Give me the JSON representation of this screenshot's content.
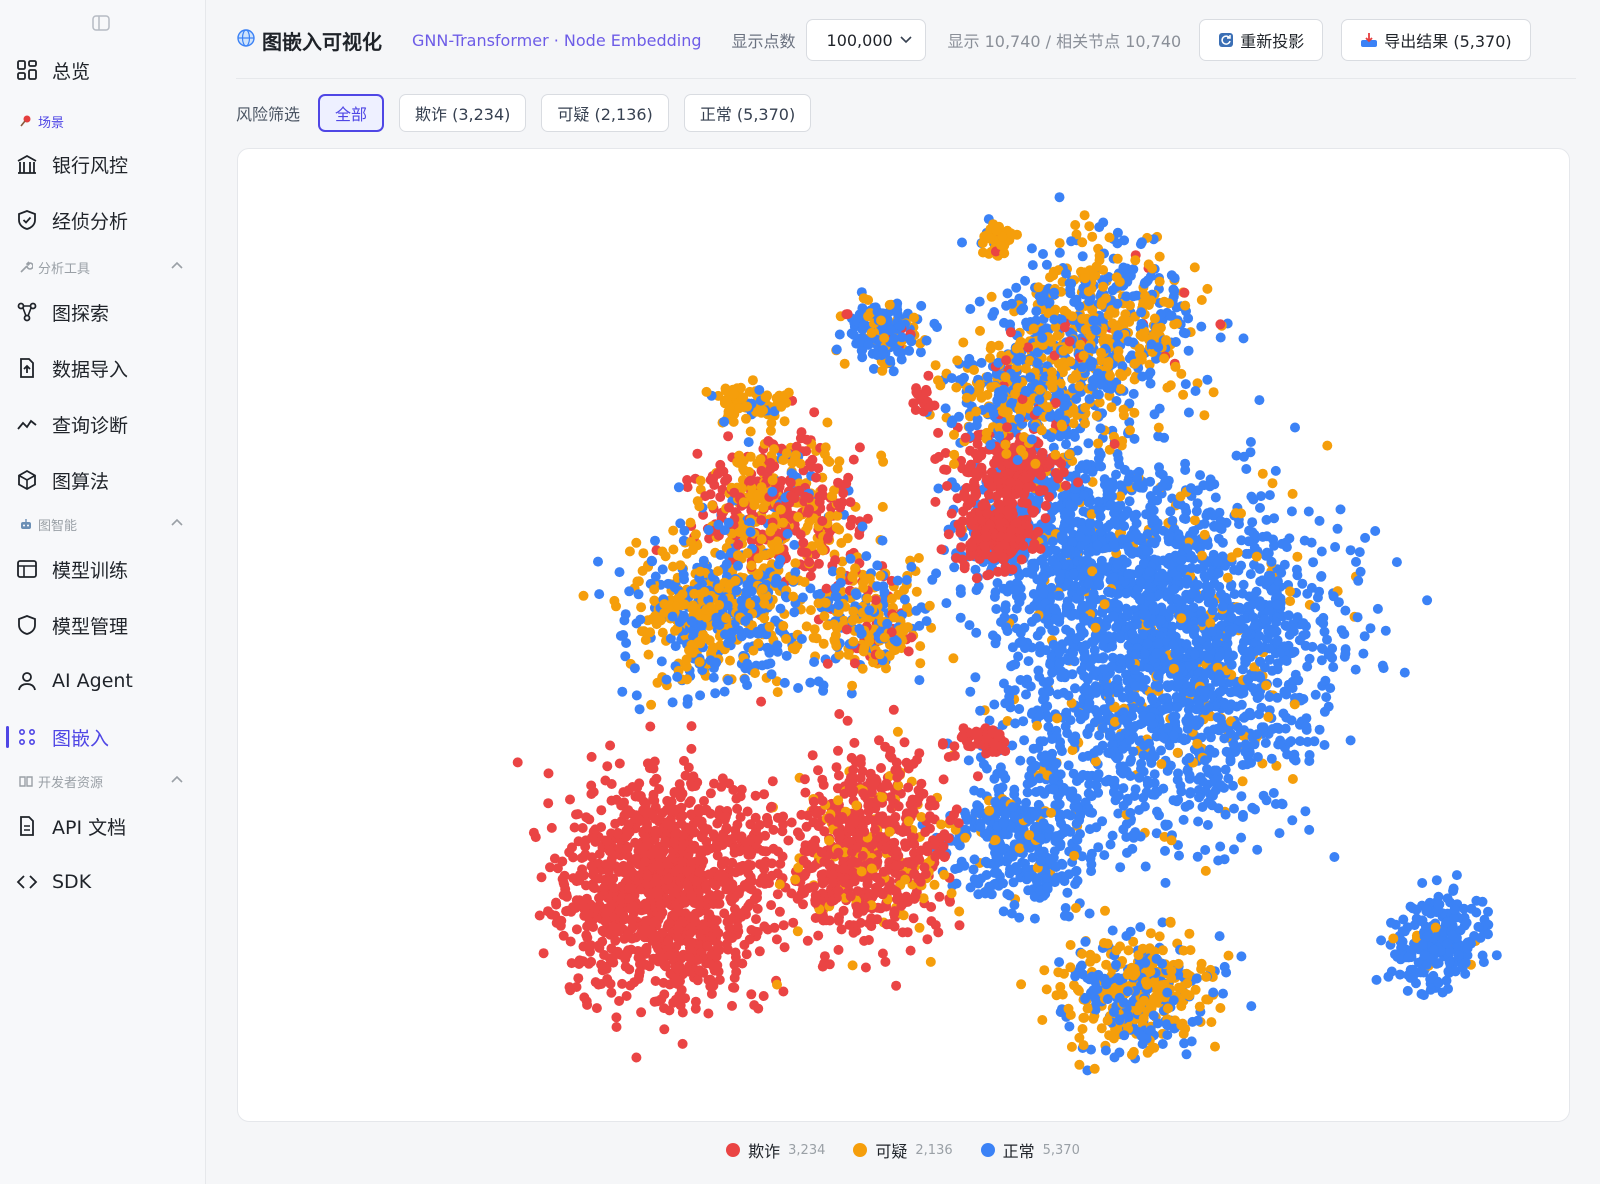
{
  "sidebar": {
    "overview": "总览",
    "section_scene": "场景",
    "bank_risk": "银行风控",
    "investigation": "经侦分析",
    "section_tools": "分析工具",
    "graph_explore": "图探索",
    "data_import": "数据导入",
    "query_diag": "查询诊断",
    "graph_algo": "图算法",
    "section_ai": "图智能",
    "model_train": "模型训练",
    "model_manage": "模型管理",
    "ai_agent": "AI Agent",
    "graph_embed": "图嵌入",
    "section_dev": "开发者资源",
    "api_docs": "API 文档",
    "sdk": "SDK"
  },
  "header": {
    "title": "图嵌入可视化",
    "subtitle": "GNN-Transformer · Node Embedding",
    "count_label": "显示点数",
    "count_value": "100,000",
    "stats": "显示 10,740 / 相关节点 10,740",
    "reproject": "重新投影",
    "export": "导出结果 (5,370)"
  },
  "filter": {
    "label": "风险筛选",
    "all": "全部",
    "fraud": "欺诈 (3,234)",
    "suspicious": "可疑 (2,136)",
    "normal": "正常 (5,370)"
  },
  "colors": {
    "fraud": "#ea4444",
    "suspicious": "#f59e0b",
    "normal": "#3b82f6",
    "accent": "#4f46e5"
  },
  "legend": [
    {
      "name": "欺诈",
      "count": "3,234",
      "color": "#ea4444"
    },
    {
      "name": "可疑",
      "count": "2,136",
      "color": "#f59e0b"
    },
    {
      "name": "正常",
      "count": "5,370",
      "color": "#3b82f6"
    }
  ],
  "chart_data": {
    "type": "scatter",
    "title": "",
    "xlabel": "",
    "ylabel": "",
    "grid": false,
    "legend_position": "bottom-center",
    "series": [
      {
        "name": "欺诈",
        "count": 3234
      },
      {
        "name": "可疑",
        "count": 2136
      },
      {
        "name": "正常",
        "count": 5370
      }
    ]
  }
}
